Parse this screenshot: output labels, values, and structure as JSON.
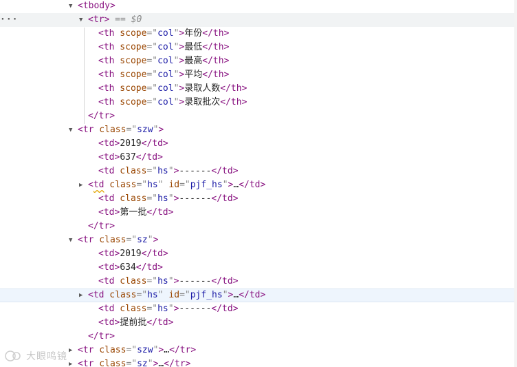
{
  "selected_marker": "== $0",
  "more_menu": "···",
  "watermark": "大眼鸣镜",
  "rows": [
    {
      "depth": 0,
      "twisty": "open",
      "parts": [
        [
          "tag",
          "<tbody>"
        ]
      ]
    },
    {
      "depth": 1,
      "twisty": "open",
      "selected": true,
      "parts": [
        [
          "tag",
          "<tr>"
        ],
        [
          "sel",
          " == $0"
        ]
      ]
    },
    {
      "depth": 2,
      "parts": [
        [
          "tag",
          "<th"
        ],
        [
          "an",
          " scope"
        ],
        [
          "punc",
          "=\""
        ],
        [
          "av",
          "col"
        ],
        [
          "punc",
          "\""
        ],
        [
          "tag",
          ">"
        ],
        [
          "txt",
          "年份"
        ],
        [
          "tag",
          "</th>"
        ]
      ]
    },
    {
      "depth": 2,
      "parts": [
        [
          "tag",
          "<th"
        ],
        [
          "an",
          " scope"
        ],
        [
          "punc",
          "=\""
        ],
        [
          "av",
          "col"
        ],
        [
          "punc",
          "\""
        ],
        [
          "tag",
          ">"
        ],
        [
          "txt",
          "最低"
        ],
        [
          "tag",
          "</th>"
        ]
      ]
    },
    {
      "depth": 2,
      "parts": [
        [
          "tag",
          "<th"
        ],
        [
          "an",
          " scope"
        ],
        [
          "punc",
          "=\""
        ],
        [
          "av",
          "col"
        ],
        [
          "punc",
          "\""
        ],
        [
          "tag",
          ">"
        ],
        [
          "txt",
          "最高"
        ],
        [
          "tag",
          "</th>"
        ]
      ]
    },
    {
      "depth": 2,
      "parts": [
        [
          "tag",
          "<th"
        ],
        [
          "an",
          " scope"
        ],
        [
          "punc",
          "=\""
        ],
        [
          "av",
          "col"
        ],
        [
          "punc",
          "\""
        ],
        [
          "tag",
          ">"
        ],
        [
          "txt",
          "平均"
        ],
        [
          "tag",
          "</th>"
        ]
      ]
    },
    {
      "depth": 2,
      "parts": [
        [
          "tag",
          "<th"
        ],
        [
          "an",
          " scope"
        ],
        [
          "punc",
          "=\""
        ],
        [
          "av",
          "col"
        ],
        [
          "punc",
          "\""
        ],
        [
          "tag",
          ">"
        ],
        [
          "txt",
          "录取人数"
        ],
        [
          "tag",
          "</th>"
        ]
      ]
    },
    {
      "depth": 2,
      "parts": [
        [
          "tag",
          "<th"
        ],
        [
          "an",
          " scope"
        ],
        [
          "punc",
          "=\""
        ],
        [
          "av",
          "col"
        ],
        [
          "punc",
          "\""
        ],
        [
          "tag",
          ">"
        ],
        [
          "txt",
          "录取批次"
        ],
        [
          "tag",
          "</th>"
        ]
      ]
    },
    {
      "depth": 1,
      "parts": [
        [
          "tag",
          "</tr>"
        ]
      ]
    },
    {
      "depth": 0,
      "twisty": "open",
      "parts": [
        [
          "tag",
          "<tr"
        ],
        [
          "an",
          " class"
        ],
        [
          "punc",
          "=\""
        ],
        [
          "av",
          "szw"
        ],
        [
          "punc",
          "\""
        ],
        [
          "tag",
          ">"
        ]
      ]
    },
    {
      "depth": 2,
      "parts": [
        [
          "tag",
          "<td>"
        ],
        [
          "txt",
          "2019"
        ],
        [
          "tag",
          "</td>"
        ]
      ]
    },
    {
      "depth": 2,
      "parts": [
        [
          "tag",
          "<td>"
        ],
        [
          "txt",
          "637"
        ],
        [
          "tag",
          "</td>"
        ]
      ]
    },
    {
      "depth": 2,
      "parts": [
        [
          "tag",
          "<td"
        ],
        [
          "an",
          " class"
        ],
        [
          "punc",
          "=\""
        ],
        [
          "av",
          "hs"
        ],
        [
          "punc",
          "\""
        ],
        [
          "tag",
          ">"
        ],
        [
          "txt",
          "------"
        ],
        [
          "tag",
          "</td>"
        ]
      ]
    },
    {
      "depth": 1,
      "twisty": "closed",
      "squiggle": true,
      "parts": [
        [
          "tag",
          "<td"
        ],
        [
          "an",
          " class"
        ],
        [
          "punc",
          "=\""
        ],
        [
          "av",
          "hs"
        ],
        [
          "punc",
          "\""
        ],
        [
          "an",
          " id"
        ],
        [
          "punc",
          "=\""
        ],
        [
          "av",
          "pjf_hs"
        ],
        [
          "punc",
          "\""
        ],
        [
          "tag",
          ">"
        ],
        [
          "txt",
          "…"
        ],
        [
          "tag",
          "</td>"
        ]
      ]
    },
    {
      "depth": 2,
      "parts": [
        [
          "tag",
          "<td"
        ],
        [
          "an",
          " class"
        ],
        [
          "punc",
          "=\""
        ],
        [
          "av",
          "hs"
        ],
        [
          "punc",
          "\""
        ],
        [
          "tag",
          ">"
        ],
        [
          "txt",
          "------"
        ],
        [
          "tag",
          "</td>"
        ]
      ]
    },
    {
      "depth": 2,
      "parts": [
        [
          "tag",
          "<td>"
        ],
        [
          "txt",
          "第一批"
        ],
        [
          "tag",
          "</td>"
        ]
      ]
    },
    {
      "depth": 1,
      "parts": [
        [
          "tag",
          "</tr>"
        ]
      ]
    },
    {
      "depth": 0,
      "twisty": "open",
      "parts": [
        [
          "tag",
          "<tr"
        ],
        [
          "an",
          " class"
        ],
        [
          "punc",
          "=\""
        ],
        [
          "av",
          "sz"
        ],
        [
          "punc",
          "\""
        ],
        [
          "tag",
          ">"
        ]
      ]
    },
    {
      "depth": 2,
      "parts": [
        [
          "tag",
          "<td>"
        ],
        [
          "txt",
          "2019"
        ],
        [
          "tag",
          "</td>"
        ]
      ]
    },
    {
      "depth": 2,
      "parts": [
        [
          "tag",
          "<td>"
        ],
        [
          "txt",
          "634"
        ],
        [
          "tag",
          "</td>"
        ]
      ]
    },
    {
      "depth": 2,
      "parts": [
        [
          "tag",
          "<td"
        ],
        [
          "an",
          " class"
        ],
        [
          "punc",
          "=\""
        ],
        [
          "av",
          "hs"
        ],
        [
          "punc",
          "\""
        ],
        [
          "tag",
          ">"
        ],
        [
          "txt",
          "------"
        ],
        [
          "tag",
          "</td>"
        ]
      ]
    },
    {
      "depth": 1,
      "twisty": "closed",
      "hover": true,
      "parts": [
        [
          "tag",
          "<td"
        ],
        [
          "an",
          " class"
        ],
        [
          "punc",
          "=\""
        ],
        [
          "av",
          "hs"
        ],
        [
          "punc",
          "\""
        ],
        [
          "an",
          " id"
        ],
        [
          "punc",
          "=\""
        ],
        [
          "av",
          "pjf_hs"
        ],
        [
          "punc",
          "\""
        ],
        [
          "tag",
          ">"
        ],
        [
          "txt",
          "…"
        ],
        [
          "tag",
          "</td>"
        ]
      ]
    },
    {
      "depth": 2,
      "parts": [
        [
          "tag",
          "<td"
        ],
        [
          "an",
          " class"
        ],
        [
          "punc",
          "=\""
        ],
        [
          "av",
          "hs"
        ],
        [
          "punc",
          "\""
        ],
        [
          "tag",
          ">"
        ],
        [
          "txt",
          "------"
        ],
        [
          "tag",
          "</td>"
        ]
      ]
    },
    {
      "depth": 2,
      "parts": [
        [
          "tag",
          "<td>"
        ],
        [
          "txt",
          "提前批"
        ],
        [
          "tag",
          "</td>"
        ]
      ]
    },
    {
      "depth": 1,
      "parts": [
        [
          "tag",
          "</tr>"
        ]
      ]
    },
    {
      "depth": 0,
      "twisty": "closed",
      "parts": [
        [
          "tag",
          "<tr"
        ],
        [
          "an",
          " class"
        ],
        [
          "punc",
          "=\""
        ],
        [
          "av",
          "szw"
        ],
        [
          "punc",
          "\""
        ],
        [
          "tag",
          ">"
        ],
        [
          "txt",
          "…"
        ],
        [
          "tag",
          "</tr>"
        ]
      ]
    },
    {
      "depth": 0,
      "twisty": "closed",
      "parts": [
        [
          "tag",
          "<tr"
        ],
        [
          "an",
          " class"
        ],
        [
          "punc",
          "=\""
        ],
        [
          "av",
          "sz"
        ],
        [
          "punc",
          "\""
        ],
        [
          "tag",
          ">"
        ],
        [
          "txt",
          "…"
        ],
        [
          "tag",
          "</tr>"
        ]
      ]
    }
  ]
}
